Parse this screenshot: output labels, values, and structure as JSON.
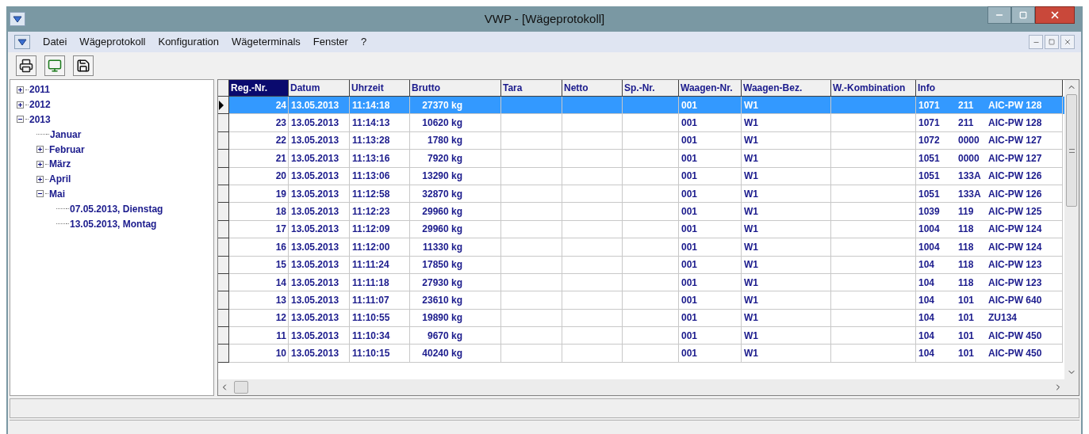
{
  "window": {
    "title": "VWP - [Wägeprotokoll]"
  },
  "menu": [
    "Datei",
    "Wägeprotokoll",
    "Konfiguration",
    "Wägeterminals",
    "Fenster",
    "?"
  ],
  "tree": [
    {
      "label": "2011",
      "has_children": true,
      "expanded": false
    },
    {
      "label": "2012",
      "has_children": true,
      "expanded": false
    },
    {
      "label": "2013",
      "has_children": true,
      "expanded": true,
      "children": [
        {
          "label": "Januar",
          "has_children": false
        },
        {
          "label": "Februar",
          "has_children": true,
          "expanded": false
        },
        {
          "label": "März",
          "has_children": true,
          "expanded": false
        },
        {
          "label": "April",
          "has_children": true,
          "expanded": false
        },
        {
          "label": "Mai",
          "has_children": true,
          "expanded": true,
          "children": [
            {
              "label": "07.05.2013, Dienstag",
              "has_children": false
            },
            {
              "label": "13.05.2013, Montag",
              "has_children": false
            }
          ]
        }
      ]
    }
  ],
  "table": {
    "columns": [
      {
        "label": "Reg.-Nr.",
        "selected": true
      },
      {
        "label": "Datum",
        "selected": false
      },
      {
        "label": "Uhrzeit",
        "selected": false
      },
      {
        "label": "Brutto",
        "selected": false
      },
      {
        "label": "Tara",
        "selected": false
      },
      {
        "label": "Netto",
        "selected": false
      },
      {
        "label": "Sp.-Nr.",
        "selected": false
      },
      {
        "label": "Waagen-Nr.",
        "selected": false
      },
      {
        "label": "Waagen-Bez.",
        "selected": false
      },
      {
        "label": "W.-Kombination",
        "selected": false
      },
      {
        "label": "Info",
        "selected": false
      }
    ],
    "rows": [
      {
        "selected": true,
        "reg_nr": "24",
        "datum": "13.05.2013",
        "uhrzeit": "11:14:18",
        "brutto": "27370 kg",
        "waagen_nr": "001",
        "waagen_bez": "W1",
        "info": [
          "1071",
          "211",
          "AIC-PW 128"
        ]
      },
      {
        "selected": false,
        "reg_nr": "23",
        "datum": "13.05.2013",
        "uhrzeit": "11:14:13",
        "brutto": "10620 kg",
        "waagen_nr": "001",
        "waagen_bez": "W1",
        "info": [
          "1071",
          "211",
          "AIC-PW 128"
        ]
      },
      {
        "selected": false,
        "reg_nr": "22",
        "datum": "13.05.2013",
        "uhrzeit": "11:13:28",
        "brutto": "1780 kg",
        "waagen_nr": "001",
        "waagen_bez": "W1",
        "info": [
          "1072",
          "0000",
          "AIC-PW 127"
        ]
      },
      {
        "selected": false,
        "reg_nr": "21",
        "datum": "13.05.2013",
        "uhrzeit": "11:13:16",
        "brutto": "7920 kg",
        "waagen_nr": "001",
        "waagen_bez": "W1",
        "info": [
          "1051",
          "0000",
          "AIC-PW 127"
        ]
      },
      {
        "selected": false,
        "reg_nr": "20",
        "datum": "13.05.2013",
        "uhrzeit": "11:13:06",
        "brutto": "13290 kg",
        "waagen_nr": "001",
        "waagen_bez": "W1",
        "info": [
          "1051",
          "133A",
          "AIC-PW 126"
        ]
      },
      {
        "selected": false,
        "reg_nr": "19",
        "datum": "13.05.2013",
        "uhrzeit": "11:12:58",
        "brutto": "32870 kg",
        "waagen_nr": "001",
        "waagen_bez": "W1",
        "info": [
          "1051",
          "133A",
          "AIC-PW 126"
        ]
      },
      {
        "selected": false,
        "reg_nr": "18",
        "datum": "13.05.2013",
        "uhrzeit": "11:12:23",
        "brutto": "29960 kg",
        "waagen_nr": "001",
        "waagen_bez": "W1",
        "info": [
          "1039",
          "119",
          "AIC-PW 125"
        ]
      },
      {
        "selected": false,
        "reg_nr": "17",
        "datum": "13.05.2013",
        "uhrzeit": "11:12:09",
        "brutto": "29960 kg",
        "waagen_nr": "001",
        "waagen_bez": "W1",
        "info": [
          "1004",
          "118",
          "AIC-PW 124"
        ]
      },
      {
        "selected": false,
        "reg_nr": "16",
        "datum": "13.05.2013",
        "uhrzeit": "11:12:00",
        "brutto": "11330 kg",
        "waagen_nr": "001",
        "waagen_bez": "W1",
        "info": [
          "1004",
          "118",
          "AIC-PW 124"
        ]
      },
      {
        "selected": false,
        "reg_nr": "15",
        "datum": "13.05.2013",
        "uhrzeit": "11:11:24",
        "brutto": "17850 kg",
        "waagen_nr": "001",
        "waagen_bez": "W1",
        "info": [
          "104",
          "118",
          "AIC-PW 123"
        ]
      },
      {
        "selected": false,
        "reg_nr": "14",
        "datum": "13.05.2013",
        "uhrzeit": "11:11:18",
        "brutto": "27930 kg",
        "waagen_nr": "001",
        "waagen_bez": "W1",
        "info": [
          "104",
          "118",
          "AIC-PW 123"
        ]
      },
      {
        "selected": false,
        "reg_nr": "13",
        "datum": "13.05.2013",
        "uhrzeit": "11:11:07",
        "brutto": "23610 kg",
        "waagen_nr": "001",
        "waagen_bez": "W1",
        "info": [
          "104",
          "101",
          "AIC-PW 640"
        ]
      },
      {
        "selected": false,
        "reg_nr": "12",
        "datum": "13.05.2013",
        "uhrzeit": "11:10:55",
        "brutto": "19890 kg",
        "waagen_nr": "001",
        "waagen_bez": "W1",
        "info": [
          "104",
          "101",
          "ZU134"
        ]
      },
      {
        "selected": false,
        "reg_nr": "11",
        "datum": "13.05.2013",
        "uhrzeit": "11:10:34",
        "brutto": "9670 kg",
        "waagen_nr": "001",
        "waagen_bez": "W1",
        "info": [
          "104",
          "101",
          "AIC-PW 450"
        ]
      },
      {
        "selected": false,
        "reg_nr": "10",
        "datum": "13.05.2013",
        "uhrzeit": "11:10:15",
        "brutto": "40240 kg",
        "waagen_nr": "001",
        "waagen_bez": "W1",
        "info": [
          "104",
          "101",
          "AIC-PW 450"
        ]
      }
    ]
  }
}
